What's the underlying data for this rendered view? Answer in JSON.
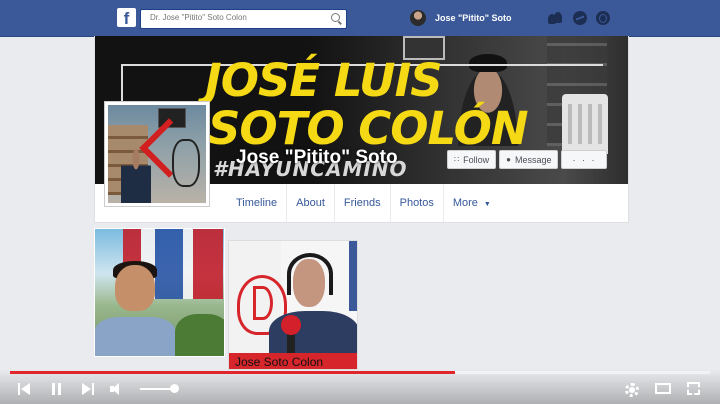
{
  "topbar": {
    "logo": "f",
    "search_placeholder": "Dr. Jose \"Pitito\" Soto Colon",
    "profile_name": "Jose \"Pitito\" Soto",
    "icons": [
      "friends-icon",
      "messenger-icon",
      "globe-icon"
    ],
    "bg_color": "#3b5998"
  },
  "cover": {
    "headline_line1": "JOSÉ LUIS",
    "headline_line2": "SOTO COLÓN",
    "hashtag": "#HAYUNCAMINO",
    "headline_color": "#f5d915"
  },
  "profile": {
    "name": "Jose \"Pitito\" Soto",
    "actions": {
      "follow": "Follow",
      "message": "Message",
      "more": "· · ·"
    }
  },
  "tabs": [
    {
      "label": "Timeline"
    },
    {
      "label": "About"
    },
    {
      "label": "Friends"
    },
    {
      "label": "Photos"
    },
    {
      "label": "More"
    }
  ],
  "photos": {
    "caption": "Jose Soto Colon"
  },
  "player": {
    "progress": 0.636,
    "volume": 0.9,
    "accent": "#e0262c"
  }
}
